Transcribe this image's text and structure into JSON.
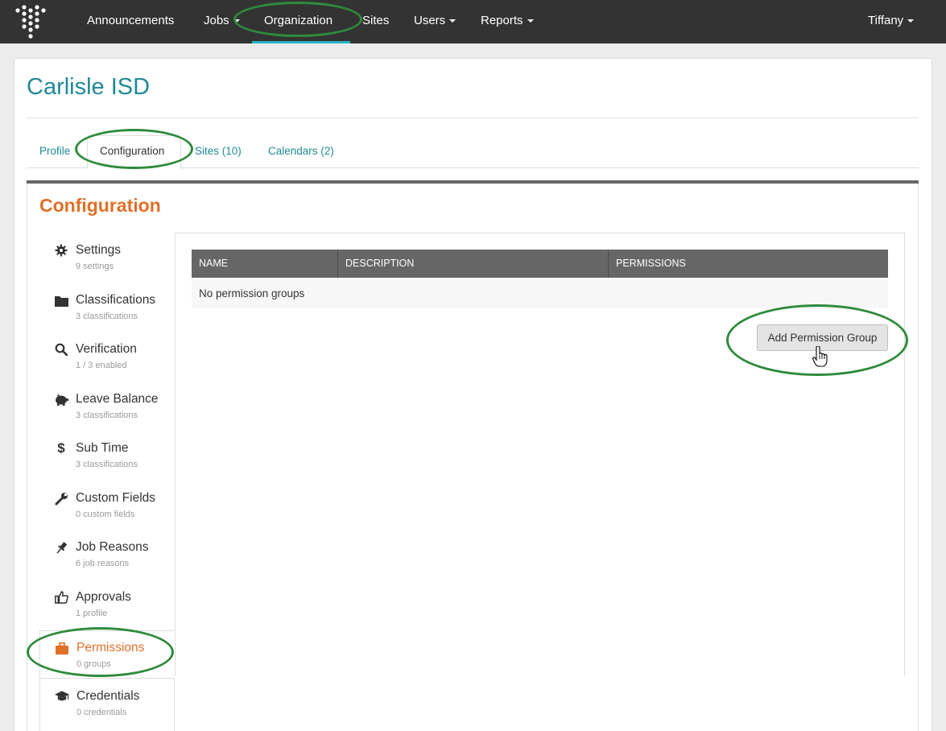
{
  "navbar": {
    "items": [
      {
        "label": "Announcements",
        "has_caret": false
      },
      {
        "label": "Jobs",
        "has_caret": true
      },
      {
        "label": "Organization",
        "has_caret": false
      },
      {
        "label": "Sites",
        "has_caret": false
      },
      {
        "label": "Users",
        "has_caret": true
      },
      {
        "label": "Reports",
        "has_caret": true
      }
    ],
    "user_label": "Tiffany",
    "logo_icon": "dot-grid-logo-icon"
  },
  "page": {
    "title": "Carlisle ISD"
  },
  "tabs": [
    {
      "label": "Profile"
    },
    {
      "label": "Configuration"
    },
    {
      "label": "Sites (10)"
    },
    {
      "label": "Calendars (2)"
    }
  ],
  "section": {
    "title": "Configuration"
  },
  "side_menu": [
    {
      "label": "Settings",
      "sub": "9 settings",
      "icon": "gear-icon"
    },
    {
      "label": "Classifications",
      "sub": "3 classifications",
      "icon": "folder-icon"
    },
    {
      "label": "Verification",
      "sub": "1 / 3 enabled",
      "icon": "search-icon"
    },
    {
      "label": "Leave Balance",
      "sub": "3 classifications",
      "icon": "piggy-bank-icon"
    },
    {
      "label": "Sub Time",
      "sub": "3 classifications",
      "icon": "dollar-icon"
    },
    {
      "label": "Custom Fields",
      "sub": "0 custom fields",
      "icon": "wrench-icon"
    },
    {
      "label": "Job Reasons",
      "sub": "6 job reasons",
      "icon": "pushpin-icon"
    },
    {
      "label": "Approvals",
      "sub": "1 profile",
      "icon": "thumbs-up-icon"
    },
    {
      "label": "Permissions",
      "sub": "0 groups",
      "icon": "briefcase-icon"
    },
    {
      "label": "Credentials",
      "sub": "0 credentials",
      "icon": "graduation-cap-icon"
    }
  ],
  "table": {
    "columns": [
      "NAME",
      "DESCRIPTION",
      "PERMISSIONS"
    ],
    "empty_text": "No permission groups"
  },
  "actions": {
    "add_label": "Add Permission Group"
  },
  "colors": {
    "navbar_bg": "#333333",
    "teal_accent": "#1f8a95",
    "orange_accent": "#e07029",
    "annotation_green": "#2e8b3c"
  }
}
